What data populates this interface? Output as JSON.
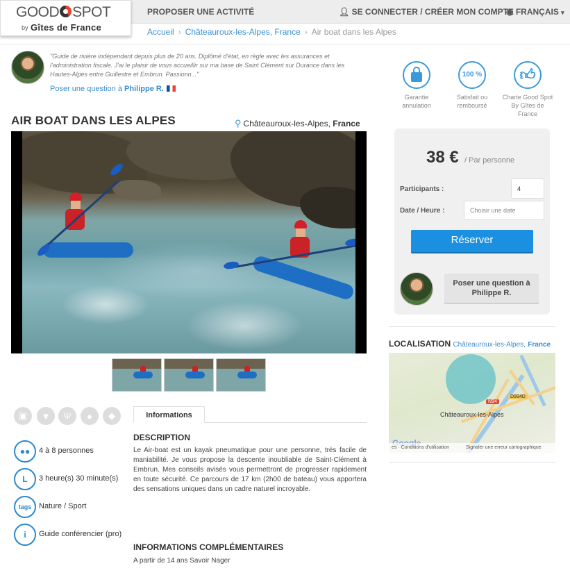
{
  "header": {
    "logo_line1a": "GOOD",
    "logo_line1b": "SPOT",
    "logo_by": "by",
    "logo_gdf": "Gîtes de France",
    "propose": "PROPOSER UNE ACTIVITÉ",
    "login": "SE CONNECTER / CRÉER MON COMPTE",
    "language": "FRANÇAIS"
  },
  "breadcrumb": {
    "home": "Accueil",
    "city": "Châteauroux-les-Alpes, France",
    "current": "Air boat dans les Alpes"
  },
  "guide": {
    "quote": "\"Guide de rivière indépendant depuis plus de 20 ans. Diplômé d'état, en règle avec les assurances et l'administration fiscale. J'ai le plaisir de vous accueillir sur ma base de Saint Clément sur Durance dans les Hautes-Alpes entre Guillestre et Embrun. Passionn...\"",
    "ask_prefix": "Poser une question à",
    "name": "Philippe R."
  },
  "badges": [
    {
      "icon": "lock-icon",
      "label": "Garantie annulation"
    },
    {
      "icon": "percent-icon",
      "symbol": "100 %",
      "label": "Satisfait ou remboursé"
    },
    {
      "icon": "thumbs-up-icon",
      "label": "Charte Good Spot By Gîtes de France"
    }
  ],
  "activity": {
    "title": "AIR BOAT DANS LES ALPES",
    "city": "Châteauroux-les-Alpes,",
    "country": "France"
  },
  "features": [
    {
      "icon": "people-icon",
      "glyph": "●●",
      "text": "4 à 8 personnes"
    },
    {
      "icon": "clock-icon",
      "glyph": "L",
      "text": "3 heure(s) 30 minute(s)"
    },
    {
      "icon": "tags-icon",
      "glyph": "tags",
      "text": "Nature / Sport"
    },
    {
      "icon": "info-icon",
      "glyph": "i",
      "text": "Guide conférencier (pro)"
    }
  ],
  "tabs": {
    "informations": "Informations"
  },
  "description": {
    "heading": "DESCRIPTION",
    "text": "Le Air-boat est un kayak pneumatique pour une personne, très facile de maniabilité. Je vous propose la descente inoubliable de Saint-Clément à Embrun. Mes conseils avisés vous permettront de progresser rapidement en toute sécurité. Ce parcours de 17 km (2h00 de bateau) vous apportera des sensations uniques dans un cadre naturel incroyable."
  },
  "info": {
    "heading": "INFORMATIONS COMPLÉMENTAIRES",
    "text": "A partir de 14 ans Savoir Nager"
  },
  "booking": {
    "price": "38 €",
    "price_unit": "/ Par personne",
    "participants_label": "Participants :",
    "participants_value": "4",
    "date_label": "Date / Heure :",
    "date_placeholder": "Choisir une date",
    "reserve": "Réserver",
    "ask_line1": "Poser une question à",
    "ask_line2": "Philippe R."
  },
  "location": {
    "heading": "LOCALISATION",
    "city": "Châteauroux-les-Alpes,",
    "country": "France",
    "map_city": "Châteauroux-les-Alpes",
    "road1": "N94",
    "road2": "D994D",
    "google": "Google",
    "footer_a": "es · Conditions d'utilisation",
    "footer_b": "Signaler une erreur cartographique"
  },
  "colors": {
    "accent": "#1b8fe0",
    "link": "#3a8fcf"
  }
}
